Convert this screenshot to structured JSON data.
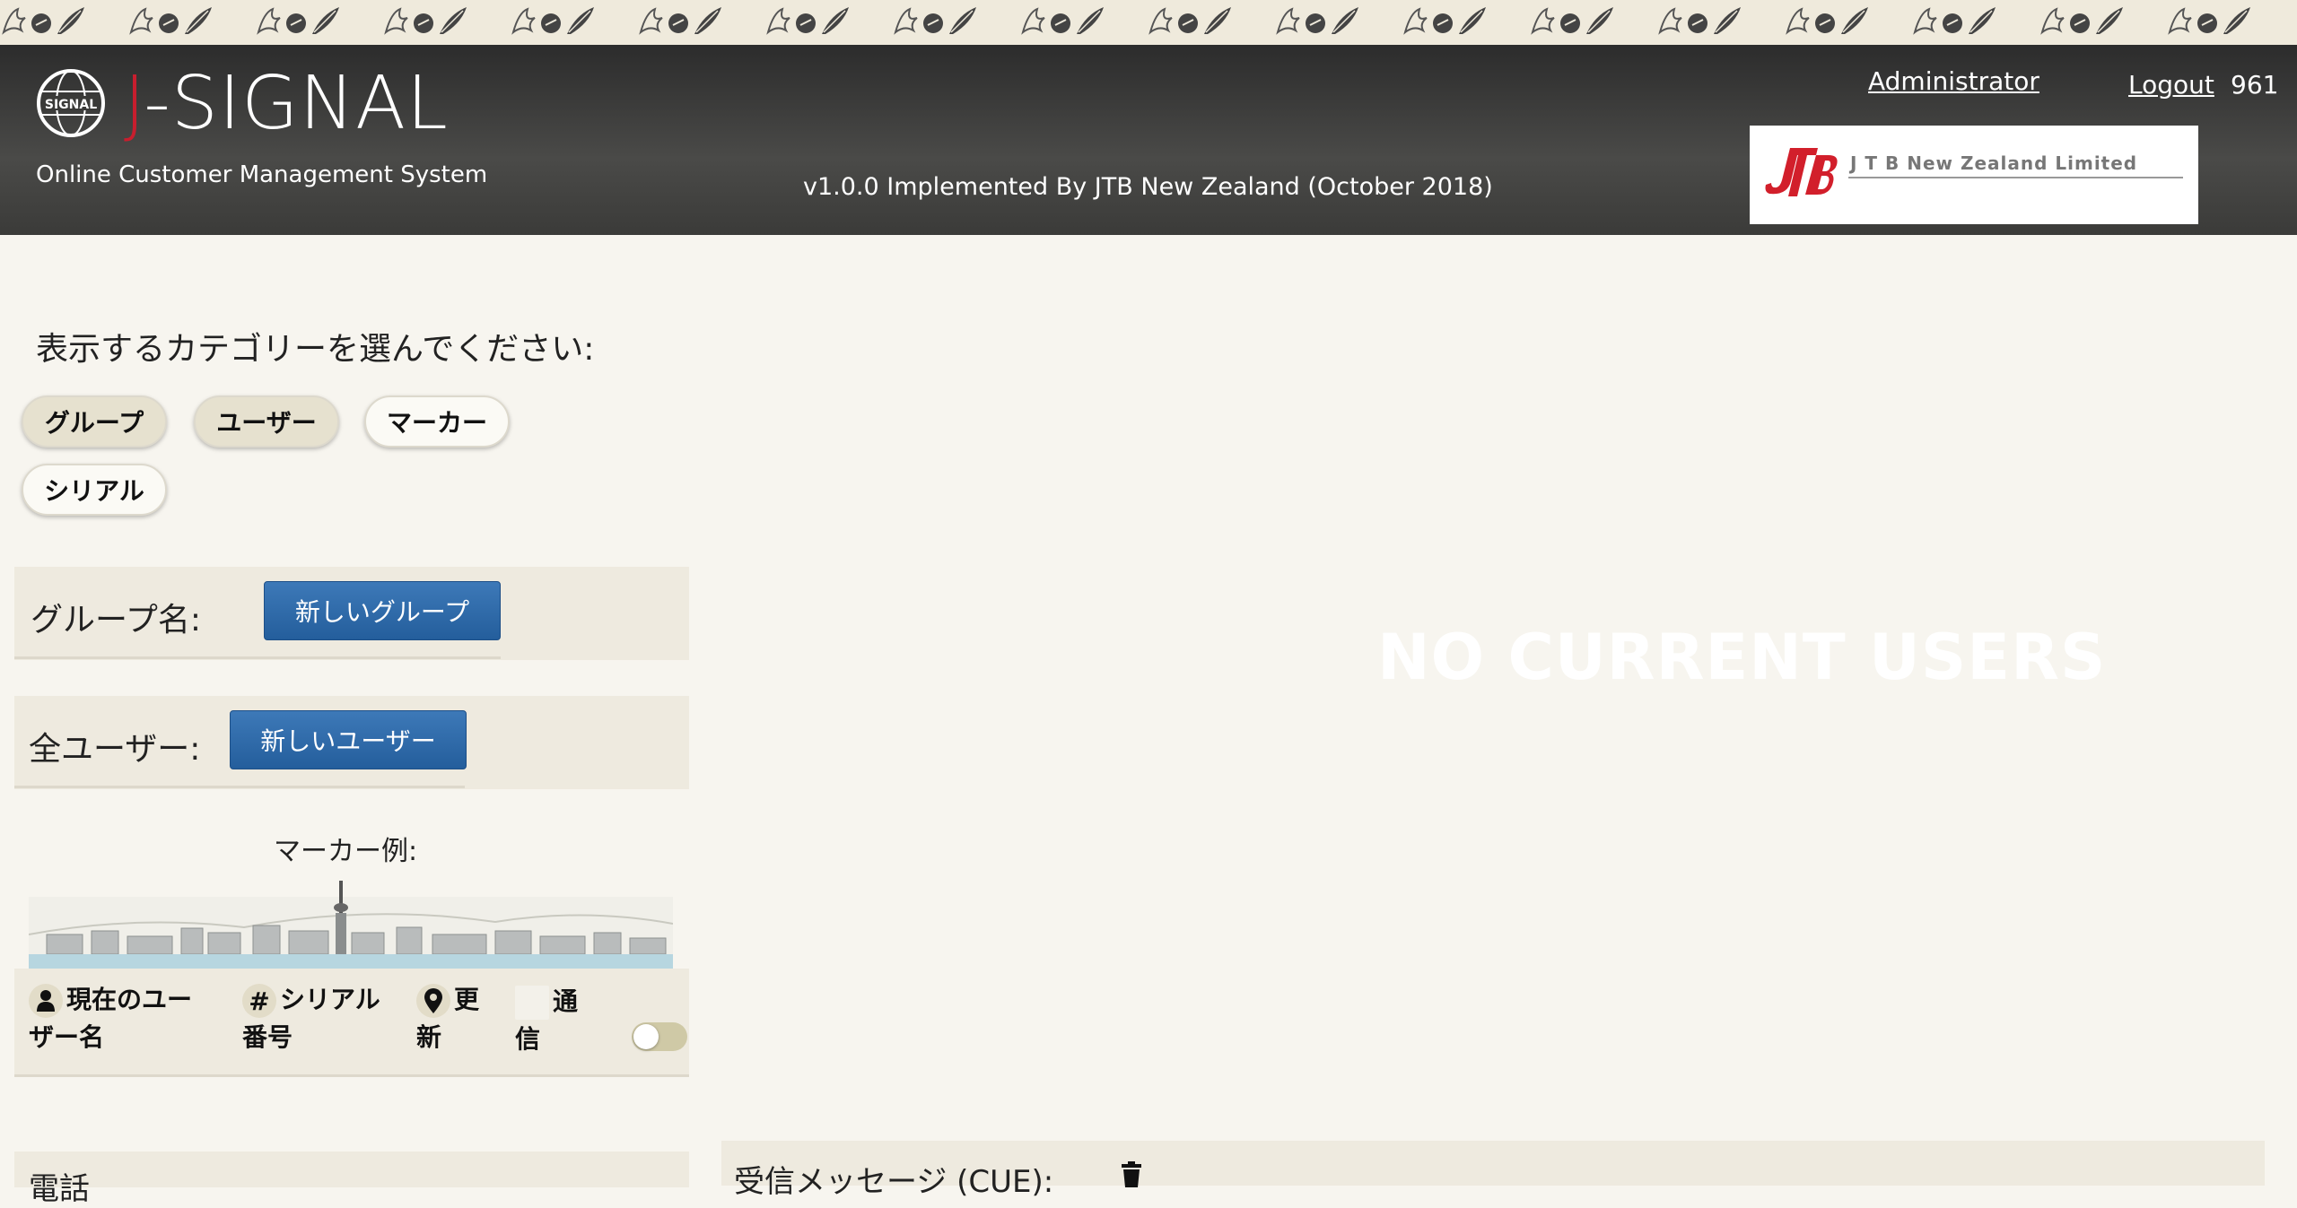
{
  "header": {
    "brand_j": "J",
    "brand_rest": "-SIGNAL",
    "subtitle": "Online Customer Management System",
    "version": "v1.0.0 Implemented By JTB New Zealand (October 2018)",
    "admin_link": "Administrator",
    "logout_link": "Logout",
    "user_number": "961",
    "company_name": "J T B New Zealand Limited"
  },
  "category": {
    "prompt": "表示するカテゴリーを選んでください:",
    "buttons": [
      {
        "label": "グループ",
        "active": true
      },
      {
        "label": "ユーザー",
        "active": true
      },
      {
        "label": "マーカー",
        "active": false
      },
      {
        "label": "シリアル",
        "active": false
      }
    ]
  },
  "groups": {
    "label": "グループ名:",
    "new_button": "新しいグループ"
  },
  "users": {
    "label": "全ユーザー:",
    "new_button": "新しいユーザー"
  },
  "marker_example": {
    "title": "マーカー例:",
    "items": [
      {
        "icon": "user-icon",
        "label": "現在のユーザー名"
      },
      {
        "icon": "hash-icon",
        "label": "シリアル番号"
      },
      {
        "icon": "location-pin-icon",
        "label": "更新"
      },
      {
        "icon": "signal-icon",
        "label": "通信"
      }
    ]
  },
  "main": {
    "empty_message": "NO CURRENT USERS"
  },
  "bottom": {
    "left_label": "電話",
    "right_label": "受信メッセージ (CUE):"
  },
  "colors": {
    "brand_red": "#c81e2e",
    "header_dark": "#3b3b39",
    "page_bg": "#f7f5ef",
    "button_blue": "#2b67a6",
    "panel_bg": "#eeeadf"
  }
}
